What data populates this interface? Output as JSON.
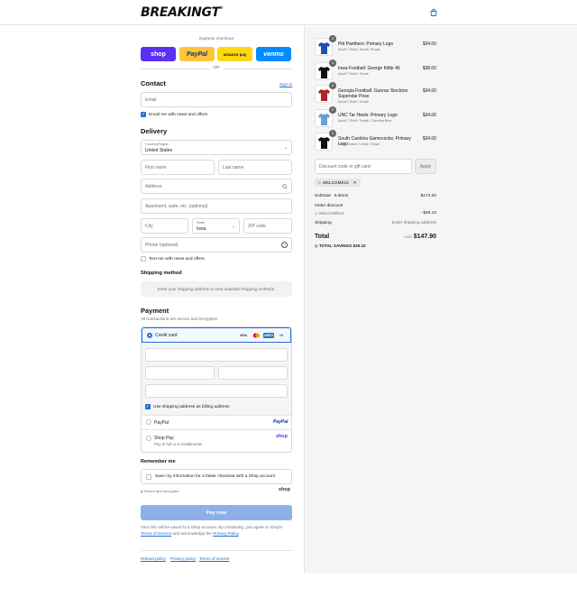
{
  "header": {
    "brand": "BREAKINGT",
    "brand_mark": "®",
    "cart_icon": "shopping-bag-icon"
  },
  "express": {
    "title": "Express checkout",
    "buttons": {
      "shop": "shop",
      "paypal": "PayPal",
      "amazon": "amazon pay",
      "venmo": "venmo"
    },
    "or": "OR"
  },
  "contact": {
    "title": "Contact",
    "sign_in": "Sign in",
    "email_placeholder": "Email",
    "email_news": "Email me with news and offers"
  },
  "delivery": {
    "title": "Delivery",
    "country_label": "Country/Region",
    "country_value": "United States",
    "first_name": "First name",
    "last_name": "Last name",
    "address": "Address",
    "apartment": "Apartment, suite, etc. (optional)",
    "city": "City",
    "state_label": "State",
    "state_value": "Iowa",
    "zip": "ZIP code",
    "phone": "Phone (optional)",
    "text_news": "Text me with news and offers"
  },
  "shipping": {
    "title": "Shipping method",
    "placeholder": "Enter your shipping address to view available shipping methods."
  },
  "payment": {
    "title": "Payment",
    "subtitle": "All transactions are secure and encrypted.",
    "credit_card": "Credit card",
    "cards": [
      "VISA",
      "MC",
      "AMEX",
      "+4"
    ],
    "billing_same": "Use shipping address as billing address",
    "paypal": "PayPal",
    "paypal_logo": "PayPal",
    "shop_pay": "Shop Pay",
    "shop_pay_sub": "Pay in full or in installments",
    "shop_logo": "shop"
  },
  "remember": {
    "title": "Remember me",
    "save_info": "Save my information for a faster checkout with a Shop account",
    "secure": "Secure and encrypted",
    "shop_logo": "shop"
  },
  "pay_now": "Pay now",
  "legal": {
    "line1": "Your info will be saved to a Shop account. By continuing, you agree to Shop's",
    "terms": "Terms of Service",
    "middle": "and acknowledge the",
    "privacy": "Privacy Policy",
    "end": "."
  },
  "footer": {
    "refund": "Refund policy",
    "privacy": "Privacy policy",
    "terms": "Terms of service"
  },
  "cart": {
    "items": [
      {
        "name": "Pitt Panthers: Primary Logo",
        "variant": "Adult T-Shirt / Small / Royal",
        "price": "$34.00",
        "qty": "1",
        "color": "#1e4fb8"
      },
      {
        "name": "Iowa Football: George Kittle 46",
        "variant": "Adult T-Shirt / Small",
        "price": "$38.00",
        "qty": "1",
        "color": "#111111"
      },
      {
        "name": "Georgia Football: Gunnar Stockton Superstar Pose",
        "variant": "Adult T-Shirt / Small",
        "price": "$34.00",
        "qty": "1",
        "color": "#b3222a"
      },
      {
        "name": "UNC Tar Heels: Primary Logo",
        "variant": "Adult T-Shirt / Small / Carolina Blue",
        "price": "$34.00",
        "qty": "1",
        "color": "#6a9fd6"
      },
      {
        "name": "South Carolina Gamecocks: Primary Logo",
        "variant": "Black / Adult T-Shirt / Small",
        "price": "$34.00",
        "qty": "1",
        "color": "#111111"
      }
    ],
    "discount_placeholder": "Discount code or gift card",
    "apply": "Apply",
    "code_tag": "WELCOME15",
    "subtotal_label": "Subtotal · 5 items",
    "subtotal": "$174.00",
    "order_discount": "Order discount",
    "discount_code": "WELCOME15",
    "discount_value": "- $26.10",
    "shipping_label": "Shipping",
    "shipping_value": "Enter shipping address",
    "total_label": "Total",
    "currency": "USD",
    "total": "$147.90",
    "savings_label": "TOTAL SAVINGS",
    "savings": "$26.10"
  }
}
